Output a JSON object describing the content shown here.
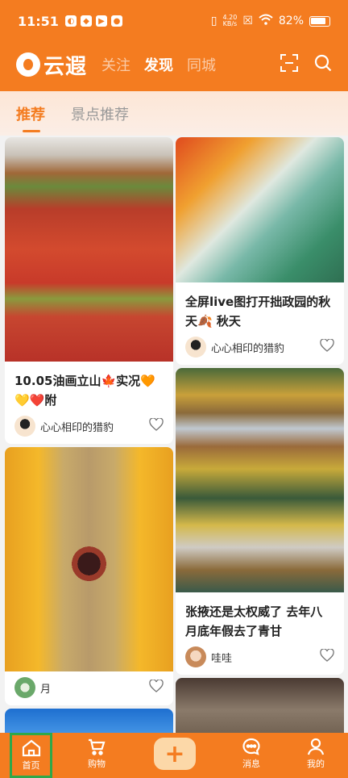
{
  "status_bar": {
    "time": "11:51",
    "net_speed_top": "4.20",
    "net_speed_bottom": "KB/s",
    "battery": "82%"
  },
  "app": {
    "logo_text": "云遐",
    "top_nav": [
      {
        "label": "关注"
      },
      {
        "label": "发现"
      },
      {
        "label": "同城"
      }
    ]
  },
  "tabs": [
    {
      "label": "推荐"
    },
    {
      "label": "景点推荐"
    }
  ],
  "feed": {
    "cards": [
      {
        "title": "10.05油画立山🍁实况🧡💛❤️附",
        "author": "心心相印的猎豹"
      },
      {
        "title": "全屏live图打开拙政园的秋天🍂 秋天",
        "author": "心心相印的猎豹"
      },
      {
        "title": "张掖还是太权威了 去年八月底年假去了青甘",
        "author": "哇哇"
      },
      {
        "title": "",
        "author": "月"
      }
    ]
  },
  "bottom_nav": {
    "home": "首页",
    "cart": "购物",
    "plus": "+",
    "messages": "消息",
    "me": "我的"
  },
  "colors": {
    "brand": "#f47c20",
    "highlight_border": "#2ea84a"
  }
}
